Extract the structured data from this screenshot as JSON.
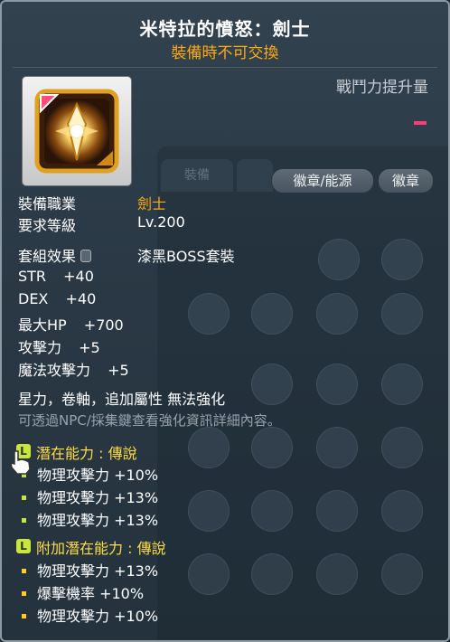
{
  "item": {
    "name": "米特拉的憤怒：劍士",
    "trade_note": "裝備時不可交換",
    "power_label": "戰鬥力提升量"
  },
  "buttons": {
    "emblem_energy": "徽章/能源",
    "emblem": "徽章"
  },
  "background_tab": "裝備",
  "requirements": {
    "job_label": "裝備職業",
    "job_value": "劍士",
    "level_label": "要求等級",
    "level_value": "Lv.200"
  },
  "set": {
    "label": "套組效果",
    "value": "漆黑BOSS套裝"
  },
  "stats": [
    {
      "name": "STR",
      "value": "+40"
    },
    {
      "name": "DEX",
      "value": "+40"
    },
    {
      "name": "最大HP",
      "value": "+700"
    },
    {
      "name": "攻擊力",
      "value": "+5"
    },
    {
      "name": "魔法攻擊力",
      "value": "+5"
    }
  ],
  "restrictions": "星力，卷軸，追加屬性 無法強化",
  "hint": "可透過NPC/採集鍵查看強化資訊詳細內容。",
  "potential": {
    "badge": "L",
    "title": "潛在能力 : 傳說",
    "lines": [
      "物理攻擊力 +10%",
      "物理攻擊力 +13%",
      "物理攻擊力 +13%"
    ]
  },
  "bonus_potential": {
    "badge": "L",
    "title": "附加潛在能力 : 傳說",
    "lines": [
      "物理攻擊力 +13%",
      "爆擊機率 +10%",
      "物理攻擊力 +10%"
    ]
  },
  "colors": {
    "title": "#ffffff",
    "accent_orange": "#ffaa11",
    "legendary_yellow": "#ffdd44",
    "legendary_badge": "#c8e63c",
    "power_indicator": "#ff3b78"
  }
}
